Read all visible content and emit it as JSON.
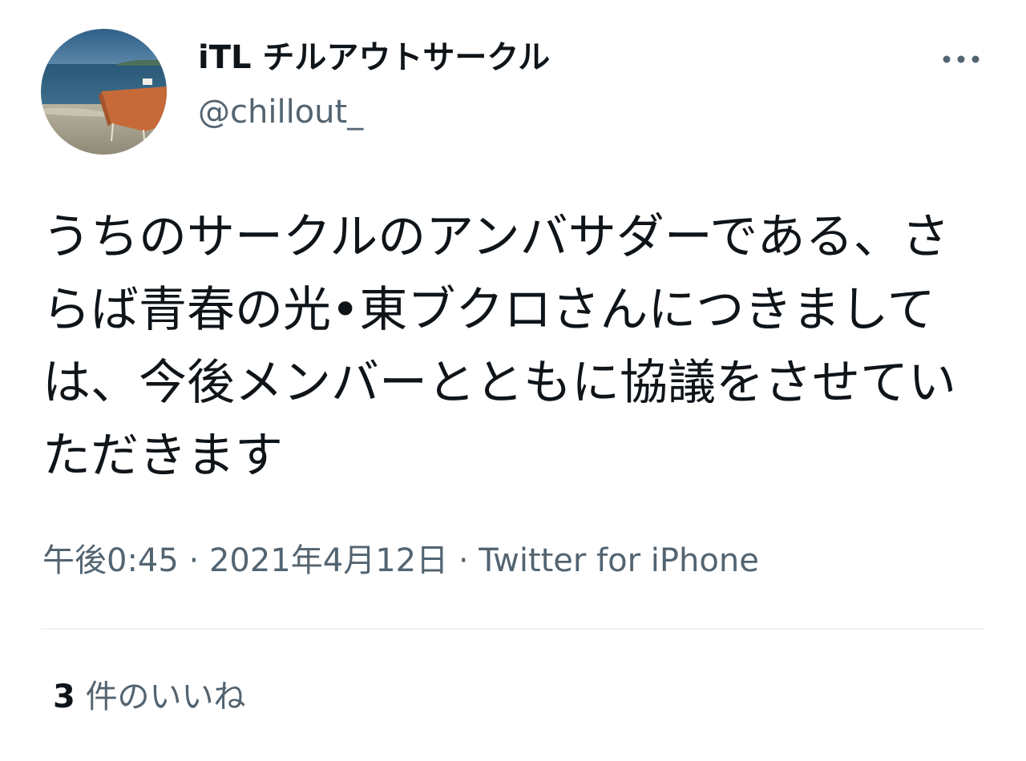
{
  "author": {
    "display_name": "iTL チルアウトサークル",
    "handle": "@chillout_",
    "avatar": "beach-table-avatar"
  },
  "tweet": {
    "text": "うちのサークルのアンバサダーである、さらば青春の光•東ブクロさんにつきましては、今後メンバーとともに協議をさせていただきます"
  },
  "meta": {
    "time": "午後0:45",
    "separator": " · ",
    "date": "2021年4月12日",
    "source": "Twitter for iPhone"
  },
  "engagement": {
    "likes_count": "3",
    "likes_label": "件のいいね"
  },
  "icons": {
    "more": "more-horizontal-icon"
  },
  "colors": {
    "text_primary": "#0f1419",
    "text_secondary": "#536471",
    "divider": "#eff3f4"
  }
}
